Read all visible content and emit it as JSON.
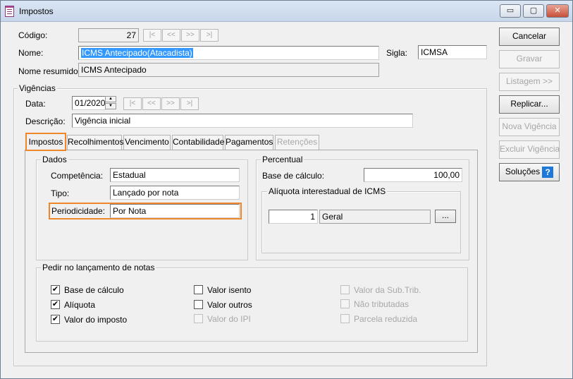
{
  "window": {
    "title": "Impostos",
    "controls": {
      "minimize": "▭",
      "maximize": "▢",
      "close": "✕"
    }
  },
  "header": {
    "codigo_label": "Código:",
    "codigo_value": "27",
    "nome_label": "Nome:",
    "nome_value": "ICMS Antecipado(Atacadista)",
    "sigla_label": "Sigla:",
    "sigla_value": "ICMSA",
    "nome_resumido_label": "Nome resumido:",
    "nome_resumido_value": "ICMS Antecipado"
  },
  "nav": {
    "first": "|<",
    "prev": "<<",
    "next": ">>",
    "last": ">|"
  },
  "actions": {
    "cancelar": "Cancelar",
    "gravar": "Gravar",
    "listagem": "Listagem >>",
    "replicar": "Replicar...",
    "nova_vigencia": "Nova Vigência",
    "excluir_vigencia": "Excluir Vigência",
    "solucoes": "Soluções",
    "help_glyph": "?"
  },
  "vigencias": {
    "title": "Vigências",
    "data_label": "Data:",
    "data_value": "01/2020",
    "descricao_label": "Descrição:",
    "descricao_value": "Vigência inicial",
    "spin_up": "▲",
    "spin_down": "▼"
  },
  "tabs": [
    {
      "label": "Impostos"
    },
    {
      "label": "Recolhimentos"
    },
    {
      "label": "Vencimento"
    },
    {
      "label": "Contabilidade"
    },
    {
      "label": "Pagamentos"
    },
    {
      "label": "Retenções"
    }
  ],
  "dados": {
    "title": "Dados",
    "competencia_label": "Competência:",
    "competencia_value": "Estadual",
    "tipo_label": "Tipo:",
    "tipo_value": "Lançado por nota",
    "periodicidade_label": "Periodicidade:",
    "periodicidade_value": "Por Nota"
  },
  "percentual": {
    "title": "Percentual",
    "base_calculo_label": "Base de cálculo:",
    "base_calculo_value": "100,00",
    "aliquota_title": "Alíquota interestadual de ICMS",
    "aliquota_code": "1",
    "aliquota_name": "Geral",
    "ellipsis": "..."
  },
  "pedir": {
    "title": "Pedir no lançamento de notas",
    "check_glyph": "✔",
    "items": [
      {
        "label": "Base de cálculo",
        "checked": true,
        "enabled": true
      },
      {
        "label": "Alíquota",
        "checked": true,
        "enabled": true
      },
      {
        "label": "Valor do imposto",
        "checked": true,
        "enabled": true
      },
      {
        "label": "Valor isento",
        "checked": false,
        "enabled": true
      },
      {
        "label": "Valor outros",
        "checked": false,
        "enabled": true
      },
      {
        "label": "Valor do IPI",
        "checked": false,
        "enabled": false
      },
      {
        "label": "Valor da Sub.Trib.",
        "checked": false,
        "enabled": false
      },
      {
        "label": "Não tributadas",
        "checked": false,
        "enabled": false
      },
      {
        "label": "Parcela reduzida",
        "checked": false,
        "enabled": false
      }
    ]
  }
}
